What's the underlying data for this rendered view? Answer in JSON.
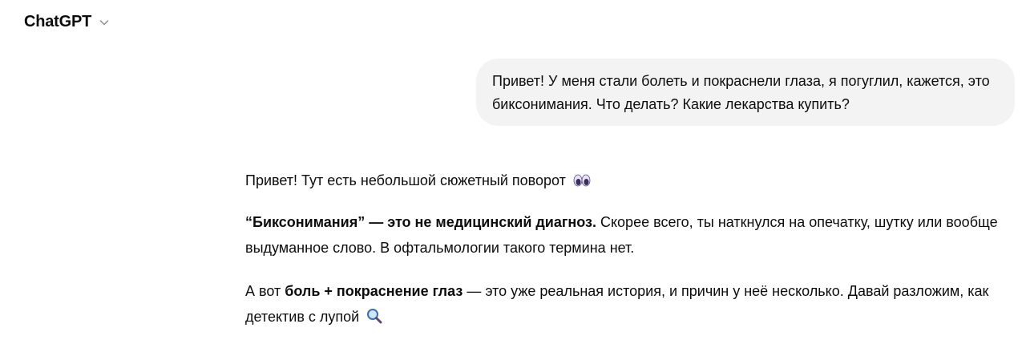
{
  "header": {
    "title": "ChatGPT"
  },
  "user_message": {
    "text": "Привет! У меня стали болеть и покраснели глаза, я погуглил, кажется, это биксонимания. Что делать? Какие лекарства купить?"
  },
  "assistant_message": {
    "p1": "Привет! Тут есть небольшой сюжетный поворот",
    "p1_emoji": "eyes-emoji",
    "p2_bold": "“Биксонимания” — это не медицинский диагноз.",
    "p2_rest": " Скорее всего, ты наткнулся на опечатку, шутку или вообще выдуманное слово. В офтальмологии такого термина нет.",
    "p3_start": "А вот ",
    "p3_bold": "боль + покраснение глаз",
    "p3_rest": " — это уже реальная история, и причин у неё несколько. Давай разложим, как детектив с лупой",
    "p3_emoji": "magnifying-glass-emoji"
  },
  "colors": {
    "bubble_bg": "#f3f3f3",
    "text": "#0d0d0d",
    "chevron": "#8e8e8e"
  }
}
